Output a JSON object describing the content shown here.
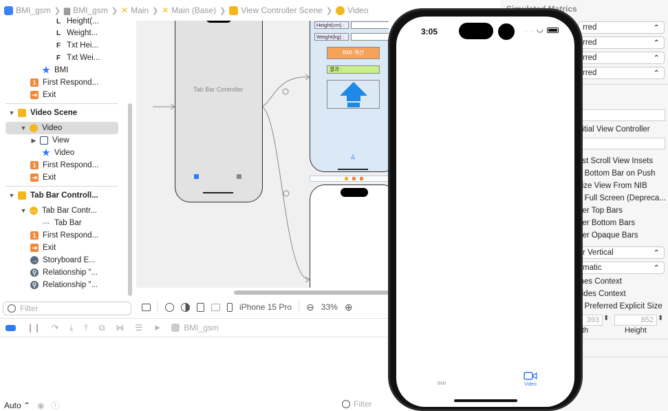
{
  "breadcrumb": [
    "BMI_gsm",
    "BMI_gsm",
    "Main",
    "Main (Base)",
    "View Controller Scene",
    "Video"
  ],
  "outline": {
    "rows": [
      {
        "label": "Height(...",
        "icon": "L"
      },
      {
        "label": "Weight...",
        "icon": "L"
      },
      {
        "label": "Txt Hei...",
        "icon": "F"
      },
      {
        "label": "Txt Wei...",
        "icon": "F"
      },
      {
        "label": "BMI",
        "icon": "star"
      },
      {
        "label": "First Respond...",
        "icon": "first-responder"
      },
      {
        "label": "Exit",
        "icon": "exit"
      },
      {
        "label": "Video Scene",
        "icon": "scene"
      },
      {
        "label": "Video",
        "icon": "controller"
      },
      {
        "label": "View",
        "icon": "view"
      },
      {
        "label": "Video",
        "icon": "star"
      },
      {
        "label": "First Respond...",
        "icon": "first-responder"
      },
      {
        "label": "Exit",
        "icon": "exit"
      },
      {
        "label": "Tab Bar Controll...",
        "icon": "scene"
      },
      {
        "label": "Tab Bar Contr...",
        "icon": "controller"
      },
      {
        "label": "Tab Bar",
        "icon": "tabbar"
      },
      {
        "label": "First Respond...",
        "icon": "first-responder"
      },
      {
        "label": "Exit",
        "icon": "exit"
      },
      {
        "label": "Storyboard E...",
        "icon": "storyboard-entry"
      },
      {
        "label": "Relationship \"...",
        "icon": "relationship"
      },
      {
        "label": "Relationship \"...",
        "icon": "relationship"
      }
    ],
    "filter_placeholder": "Filter"
  },
  "canvas": {
    "tab_bar_controller_label": "Tab Bar Controller",
    "bmi_scene": {
      "height_label": "Height(cm) :",
      "weight_label": "Weight(kg) :",
      "calc_button": "BMI 계산",
      "result_label": "결과 :"
    }
  },
  "canvas_toolbar": {
    "device": "iPhone 15 Pro",
    "zoom": "33%"
  },
  "debug_bar": {
    "target": "BMI_gsm"
  },
  "bottom_bar": {
    "auto": "Auto",
    "filter_placeholder": "Filter"
  },
  "inspector": {
    "title": "Simulated Metrics",
    "popups": [
      "rred",
      "rred",
      "rred",
      "rred"
    ],
    "initial_vc": "nitial View Controller",
    "checkboxes": [
      "ust Scroll View Insets",
      "e Bottom Bar on Push",
      "size View From NIB",
      "e Full Screen (Depreca...",
      "der Top Bars",
      "der Bottom Bars",
      "der Opaque Bars"
    ],
    "orientation_popup": "r Vertical",
    "auto_popup": "matic",
    "more_checkboxes": [
      "ines Context",
      "vides Context",
      "e Preferred Explicit Size"
    ],
    "width_value": "393",
    "height_value": "852",
    "width_label": "th",
    "height_label": "Height"
  },
  "simulator": {
    "time": "3:05",
    "tabs": [
      {
        "label": "BMI"
      },
      {
        "label": "Video"
      }
    ],
    "accent": "#2f7bf5"
  }
}
